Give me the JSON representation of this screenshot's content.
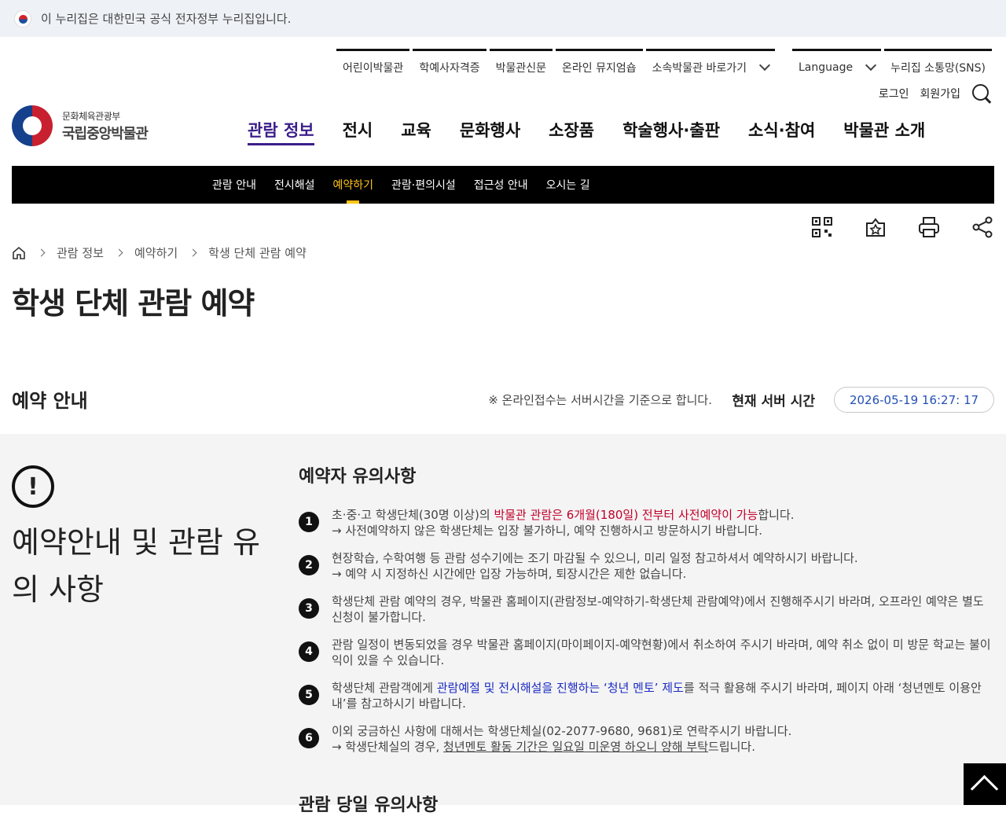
{
  "gov_bar": {
    "text": "이 누리집은 대한민국 공식 전자정부 누리집입니다."
  },
  "util": {
    "items": [
      "어린이박물관",
      "학예사자격증",
      "박물관신문",
      "온라인 뮤지엄숍",
      "소속박물관 바로가기"
    ],
    "language": "Language",
    "sns": "누리집 소통망(SNS)",
    "login": "로그인",
    "join": "회원가입"
  },
  "logo": {
    "sub": "문화체육관광부",
    "main": "국립중앙박물관"
  },
  "gnb": [
    "관람 정보",
    "전시",
    "교육",
    "문화행사",
    "소장품",
    "학술행사·출판",
    "소식·참여",
    "박물관 소개"
  ],
  "lnb": [
    "관람 안내",
    "전시해설",
    "예약하기",
    "관람·편의시설",
    "접근성 안내",
    "오시는 길"
  ],
  "breadcrumb": [
    "관람 정보",
    "예약하기",
    "학생 단체 관람 예약"
  ],
  "page_title": "학생 단체 관람 예약",
  "section": {
    "title": "예약 안내",
    "server_note": "※ 온라인접수는 서버시간을 기준으로 합니다.",
    "server_label": "현재 서버 시간",
    "server_time": "2026-05-19 16:27: 17"
  },
  "panel": {
    "left_title": "예약안내 및 관람 유의 사항",
    "notes_title": "예약자 유의사항",
    "notes": [
      {
        "num": "1",
        "a": "초·중·고 학생단체(30명 이상)의 ",
        "hl": "박물관 관람은 6개월(180일) 전부터 사전예약이 가능",
        "b": "합니다.",
        "line2": "→ 사전예약하지 않은 학생단체는 입장 불가하니, 예약 진행하시고 방문하시기 바랍니다."
      },
      {
        "num": "2",
        "a": "현장학습, 수학여행 등 관람 성수기에는 조기 마감될 수 있으니, 미리 일정 참고하셔서 예약하시기 바랍니다.",
        "line2": "→ 예약 시 지정하신 시간에만 입장 가능하며, 퇴장시간은 제한 없습니다."
      },
      {
        "num": "3",
        "a": "학생단체 관람 예약의 경우, 박물관 홈페이지(관람정보-예약하기-학생단체 관람예약)에서 진행해주시기 바라며, 오프라인 예약은 별도 신청이 불가합니다."
      },
      {
        "num": "4",
        "a": "관람 일정이 변동되었을 경우 박물관 홈페이지(마이페이지-예약현황)에서 취소하여 주시기 바라며, 예약 취소 없이 미 방문 학교는 불이익이 있을 수 있습니다."
      },
      {
        "num": "5",
        "a": "학생단체 관람객에게 ",
        "hl": "관람예절 및 전시해설을 진행하는 ‘청년 멘토’ 제도",
        "b": "를 적극 활용해 주시기 바라며, 페이지 아래 ‘청년멘토 이용안내’를 참고하시기 바랍니다."
      },
      {
        "num": "6",
        "a": "이외 궁금하신 사항에 대해서는 학생단체실(02-2077-9680, 9681)로 연락주시기 바랍니다.",
        "line2a": "→ 학생단체실의 경우, ",
        "line2u": "청년멘토 활동 기간은 일요일 미운영 하오니 양해 부탁",
        "line2b": "드립니다."
      }
    ],
    "notes_title2": "관람 당일 유의사항"
  }
}
